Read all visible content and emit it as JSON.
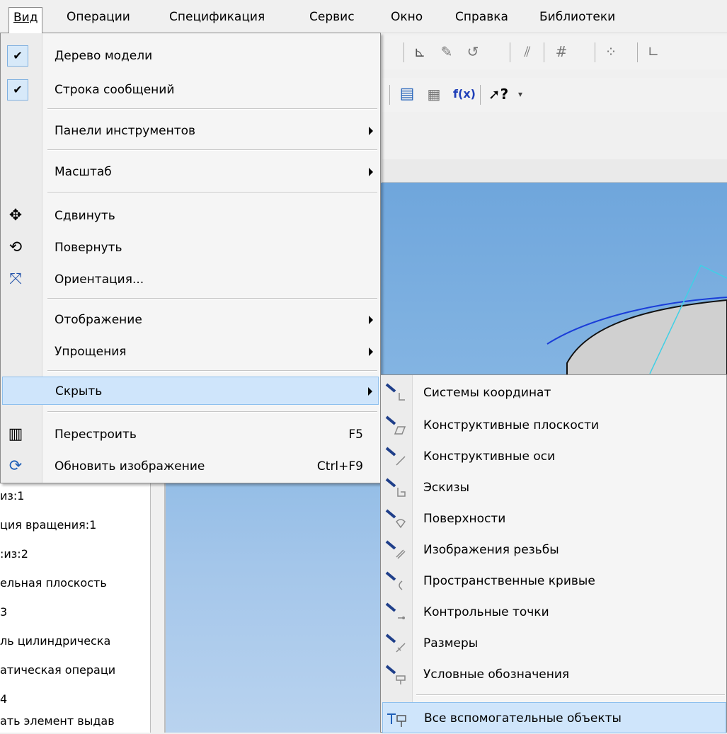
{
  "menubar": {
    "items": [
      {
        "label": "Вид"
      },
      {
        "label": "Операции"
      },
      {
        "label": "Спецификация"
      },
      {
        "label": "Сервис"
      },
      {
        "label": "Окно"
      },
      {
        "label": "Справка"
      },
      {
        "label": "Библиотеки"
      }
    ]
  },
  "view_menu": {
    "model_tree": "Дерево модели",
    "message_bar": "Строка сообщений",
    "toolbars": "Панели инструментов",
    "zoom": "Масштаб",
    "pan": "Сдвинуть",
    "rotate": "Повернуть",
    "orientation": "Ориентация...",
    "display": "Отображение",
    "simplify": "Упрощения",
    "hide": "Скрыть",
    "rebuild": "Перестроить",
    "rebuild_shortcut": "F5",
    "refresh": "Обновить изображение",
    "refresh_shortcut": "Ctrl+F9"
  },
  "hide_submenu": {
    "items": [
      {
        "label": "Системы координат"
      },
      {
        "label": "Конструктивные плоскости"
      },
      {
        "label": "Конструктивные оси"
      },
      {
        "label": "Эскизы"
      },
      {
        "label": "Поверхности"
      },
      {
        "label": "Изображения резьбы"
      },
      {
        "label": "Пространственные кривые"
      },
      {
        "label": "Контрольные точки"
      },
      {
        "label": "Размеры"
      },
      {
        "label": "Условные обозначения"
      }
    ],
    "all": "Все вспомогательные объекты"
  },
  "toolbar": {
    "fx_label": "f(x)",
    "help_label": "?"
  },
  "tree_panel": {
    "rows": [
      "из:1",
      "ция вращения:1",
      ":из:2",
      "ельная плоскость",
      "3",
      "ль цилиндрическа",
      "атическая операци",
      "4",
      "ать элемент выдав"
    ]
  },
  "colors": {
    "menu_highlight": "#cfe5fb",
    "viewport_top": "#6fa6dc",
    "viewport_bottom": "#b9d3ef",
    "curve_blue": "#1a3dd8",
    "axis_cyan": "#3fd0e6"
  }
}
